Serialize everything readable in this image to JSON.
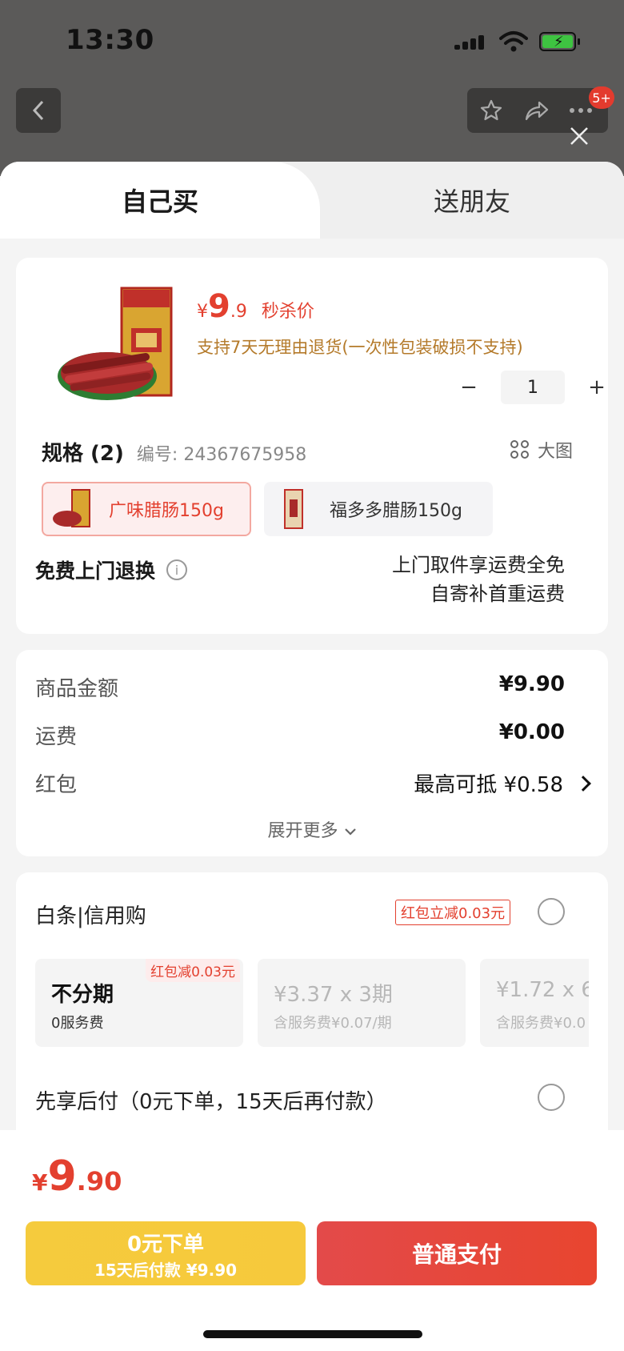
{
  "status_bar": {
    "time": "13:30"
  },
  "top_bar": {
    "badge": "5+"
  },
  "tabs": {
    "self": "自己买",
    "gift": "送朋友"
  },
  "product": {
    "price_yen": "¥",
    "price_int": "9",
    "price_dec": ".9",
    "price_tag": "秒杀价",
    "return_policy": "支持7天无理由退货(一次性包装破损不支持)",
    "quantity": "1"
  },
  "spec": {
    "title": "规格 (2)",
    "code": "编号: 24367675958",
    "big_view": "大图",
    "options": [
      {
        "label": "广味腊肠150g"
      },
      {
        "label": "福多多腊肠150g"
      }
    ]
  },
  "free_return": {
    "title": "免费上门退换",
    "note_line1": "上门取件享运费全免",
    "note_line2": "自寄补首重运费"
  },
  "summary": {
    "goods_label": "商品金额",
    "goods_value": "¥9.90",
    "shipping_label": "运费",
    "shipping_value": "¥0.00",
    "redpacket_label": "红包",
    "redpacket_value": "最高可抵 ¥0.58",
    "expand_label": "展开更多"
  },
  "payment": {
    "credit_title": "白条|信用购",
    "credit_tag": "红包立减0.03元",
    "plans": [
      {
        "main": "不分期",
        "sub": "0服务费",
        "tag": "红包减0.03元"
      },
      {
        "main": "¥3.37 x 3期",
        "sub": "含服务费¥0.07/期"
      },
      {
        "main": "¥1.72 x 6",
        "sub": "含服务费¥0.0"
      }
    ],
    "pay_later": "先享后付（0元下单，15天后再付款）"
  },
  "bottom": {
    "total_yen": "¥",
    "total_int": "9",
    "total_dec": ".90",
    "later_line1": "0元下单",
    "later_line2": "15天后付款 ¥9.90",
    "pay_label": "普通支付"
  },
  "colors": {
    "accent": "#e3402f",
    "gold": "#f5cb3d",
    "policy": "#b47a2a"
  }
}
